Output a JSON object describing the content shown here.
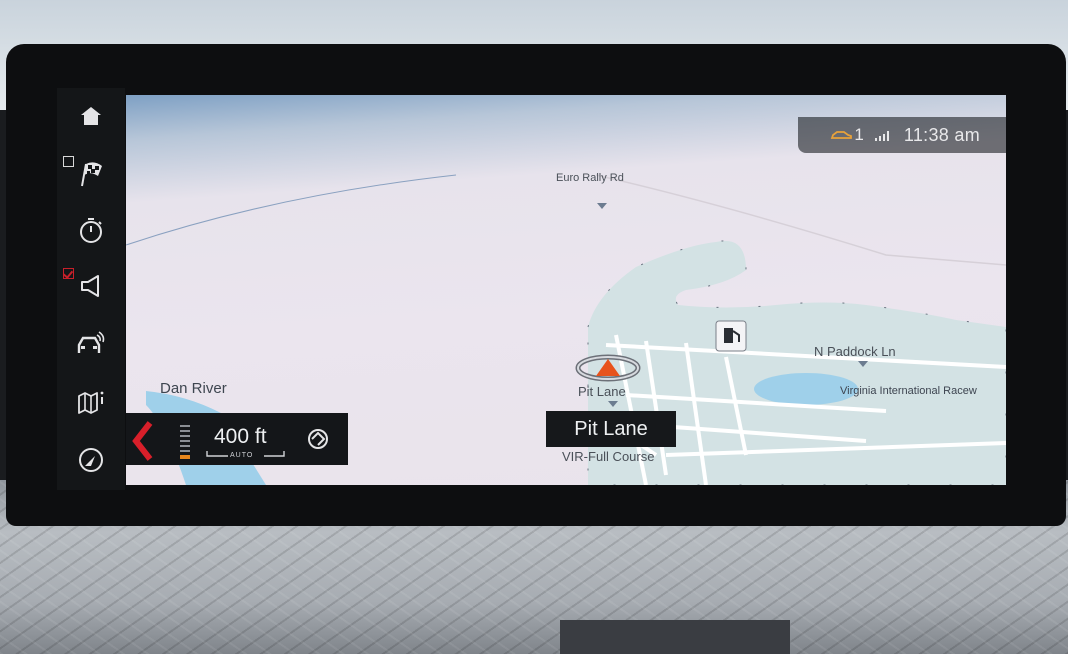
{
  "sidebar": {
    "items": [
      {
        "name": "home",
        "icon": "home-icon"
      },
      {
        "name": "destination",
        "icon": "checkered-flag-icon",
        "checkbox": false
      },
      {
        "name": "timer",
        "icon": "stopwatch-icon"
      },
      {
        "name": "voice-guidance",
        "icon": "speaker-icon",
        "checkbox": true
      },
      {
        "name": "traffic",
        "icon": "traffic-icon"
      },
      {
        "name": "map-view",
        "icon": "map-info-icon"
      },
      {
        "name": "route",
        "icon": "compass-icon"
      }
    ]
  },
  "status": {
    "vehicle_count": "1",
    "time": "11:38 am"
  },
  "map": {
    "labels": {
      "euro_rally_rd": "Euro Rally Rd",
      "dan_river": "Dan River",
      "pit_lane": "Pit Lane",
      "n_paddock_ln": "N Paddock Ln",
      "virginia_international": "Virginia International Racew",
      "vir_full_course": "VIR-Full Course"
    },
    "colors": {
      "water": "#9fd0ea",
      "land": "#d3e2e4",
      "road": "#ffffff",
      "vehicle_marker": "#e8531c"
    }
  },
  "guidance": {
    "distance": "400 ft",
    "zoom_mode": "AUTO"
  },
  "current_street": "Pit Lane"
}
